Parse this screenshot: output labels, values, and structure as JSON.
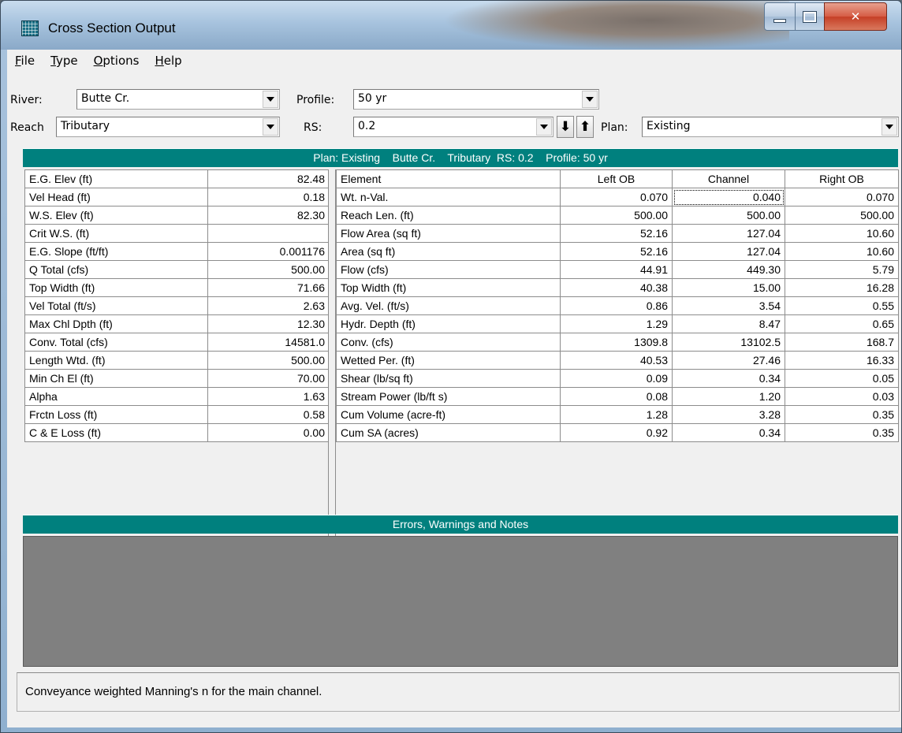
{
  "window": {
    "title": "Cross Section Output"
  },
  "menu": [
    {
      "key": "F",
      "rest": "ile"
    },
    {
      "key": "T",
      "rest": "ype"
    },
    {
      "key": "O",
      "rest": "ptions"
    },
    {
      "key": "H",
      "rest": "elp"
    }
  ],
  "selectors": {
    "river_label": "River:",
    "river_value": "Butte Cr.",
    "profile_label": "Profile:",
    "profile_value": "50 yr",
    "reach_label": "Reach",
    "reach_value": "Tributary",
    "rs_label": "RS:",
    "rs_value": "0.2",
    "plan_label": "Plan:",
    "plan_value": "Existing"
  },
  "summary_header": "Plan: Existing    Butte Cr.    Tributary  RS: 0.2    Profile: 50 yr",
  "left_table": [
    [
      "E.G. Elev (ft)",
      "82.48"
    ],
    [
      "Vel Head (ft)",
      "0.18"
    ],
    [
      "W.S. Elev (ft)",
      "82.30"
    ],
    [
      "Crit W.S. (ft)",
      ""
    ],
    [
      "E.G. Slope (ft/ft)",
      "0.001176"
    ],
    [
      "Q Total (cfs)",
      "500.00"
    ],
    [
      "Top Width (ft)",
      "71.66"
    ],
    [
      "Vel Total (ft/s)",
      "2.63"
    ],
    [
      "Max Chl Dpth (ft)",
      "12.30"
    ],
    [
      "Conv. Total (cfs)",
      "14581.0"
    ],
    [
      "Length Wtd. (ft)",
      "500.00"
    ],
    [
      "Min Ch El (ft)",
      "70.00"
    ],
    [
      "Alpha",
      "1.63"
    ],
    [
      "Frctn Loss (ft)",
      "0.58"
    ],
    [
      "C & E Loss (ft)",
      "0.00"
    ]
  ],
  "right_table": {
    "headers": [
      "Element",
      "Left OB",
      "Channel",
      "Right OB"
    ],
    "rows": [
      [
        "Wt. n-Val.",
        "0.070",
        "0.040",
        "0.070"
      ],
      [
        "Reach Len. (ft)",
        "500.00",
        "500.00",
        "500.00"
      ],
      [
        "Flow Area (sq ft)",
        "52.16",
        "127.04",
        "10.60"
      ],
      [
        "Area (sq ft)",
        "52.16",
        "127.04",
        "10.60"
      ],
      [
        "Flow (cfs)",
        "44.91",
        "449.30",
        "5.79"
      ],
      [
        "Top Width (ft)",
        "40.38",
        "15.00",
        "16.28"
      ],
      [
        "Avg. Vel. (ft/s)",
        "0.86",
        "3.54",
        "0.55"
      ],
      [
        "Hydr. Depth (ft)",
        "1.29",
        "8.47",
        "0.65"
      ],
      [
        "Conv. (cfs)",
        "1309.8",
        "13102.5",
        "168.7"
      ],
      [
        "Wetted Per. (ft)",
        "40.53",
        "27.46",
        "16.33"
      ],
      [
        "Shear (lb/sq ft)",
        "0.09",
        "0.34",
        "0.05"
      ],
      [
        "Stream Power (lb/ft s)",
        "0.08",
        "1.20",
        "0.03"
      ],
      [
        "Cum Volume (acre-ft)",
        "1.28",
        "3.28",
        "0.35"
      ],
      [
        "Cum SA (acres)",
        "0.92",
        "0.34",
        "0.35"
      ]
    ]
  },
  "notes_header": "Errors, Warnings and Notes",
  "status": "Conveyance weighted Manning's n for the main channel."
}
